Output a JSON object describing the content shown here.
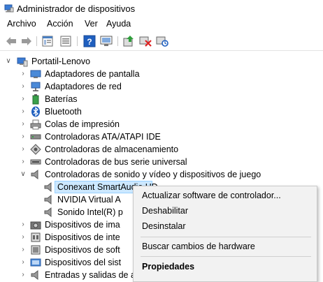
{
  "window": {
    "title": "Administrador de dispositivos"
  },
  "menu": {
    "items": [
      "Archivo",
      "Acción",
      "Ver",
      "Ayuda"
    ]
  },
  "toolbar": {
    "buttons": [
      "back-arrow-icon",
      "forward-arrow-icon",
      "properties-sheet-icon",
      "device-list-icon",
      "help-icon",
      "monitor-view-icon",
      "update-driver-icon",
      "uninstall-device-icon",
      "scan-hardware-icon"
    ]
  },
  "tree": {
    "root": "Portatil-Lenovo",
    "items": [
      {
        "label": "Adaptadores de pantalla",
        "icon": "display-adapter-icon",
        "expanded": false
      },
      {
        "label": "Adaptadores de red",
        "icon": "network-adapter-icon",
        "expanded": false
      },
      {
        "label": "Baterías",
        "icon": "battery-icon",
        "expanded": false
      },
      {
        "label": "Bluetooth",
        "icon": "bluetooth-icon",
        "expanded": false
      },
      {
        "label": "Colas de impresión",
        "icon": "printer-icon",
        "expanded": false
      },
      {
        "label": "Controladoras ATA/ATAPI IDE",
        "icon": "ide-controller-icon",
        "expanded": false
      },
      {
        "label": "Controladoras de almacenamiento",
        "icon": "storage-controller-icon",
        "expanded": false
      },
      {
        "label": "Controladoras de bus serie universal",
        "icon": "usb-controller-icon",
        "expanded": false
      },
      {
        "label": "Controladoras de sonido y vídeo y dispositivos de juego",
        "icon": "speaker-icon",
        "expanded": true
      }
    ],
    "children": [
      {
        "label": "Conexant SmartAudio HD",
        "icon": "speaker-icon",
        "selected": true
      },
      {
        "label": "NVIDIA Virtual A",
        "icon": "speaker-icon"
      },
      {
        "label": "Sonido Intel(R) p",
        "icon": "speaker-icon"
      }
    ],
    "more": [
      {
        "label": "Dispositivos de ima",
        "icon": "camera-icon"
      },
      {
        "label": "Dispositivos de inte",
        "icon": "hid-device-icon"
      },
      {
        "label": "Dispositivos de soft",
        "icon": "software-device-icon"
      },
      {
        "label": "Dispositivos del sist",
        "icon": "system-device-icon"
      },
      {
        "label": "Entradas y salidas de audio",
        "icon": "audio-io-icon"
      }
    ]
  },
  "context_menu": {
    "items": [
      {
        "label": "Actualizar software de controlador...",
        "bold": false
      },
      {
        "label": "Deshabilitar",
        "bold": false
      },
      {
        "label": "Desinstalar",
        "bold": false
      },
      {
        "label": "Buscar cambios de hardware",
        "bold": false
      },
      {
        "label": "Propiedades",
        "bold": true
      }
    ]
  }
}
